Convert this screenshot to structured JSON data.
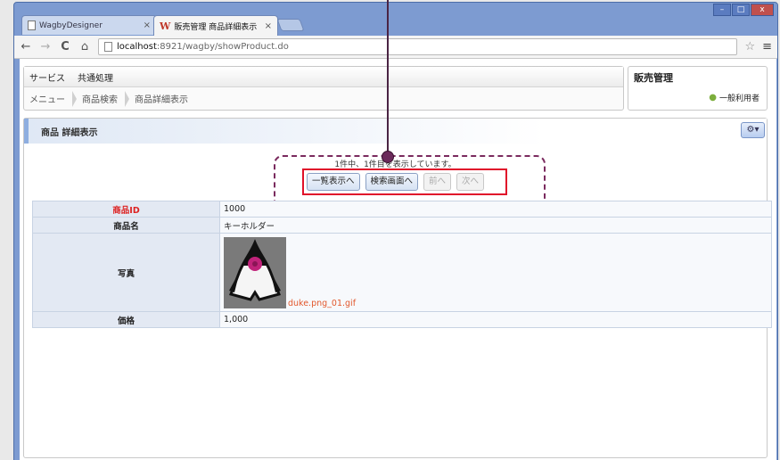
{
  "browser": {
    "tabs": [
      {
        "title": "WagbyDesigner",
        "close": "×"
      },
      {
        "title": "販売管理 商品詳細表示",
        "close": "×",
        "icon_letter": "W"
      }
    ],
    "window_controls": [
      "–",
      "□",
      "x"
    ],
    "nav": {
      "back": "←",
      "forward": "→",
      "reload": "C",
      "home": "⌂"
    },
    "url_host": "localhost",
    "url_rest": ":8921/wagby/showProduct.do",
    "star": "☆",
    "menu": "≡"
  },
  "app": {
    "menu_items": [
      "サービス",
      "共通処理"
    ],
    "breadcrumbs": [
      "メニュー",
      "商品検索",
      "商品詳細表示"
    ],
    "system_title": "販売管理",
    "user_label": "一般利用者"
  },
  "panel": {
    "title": "商品 詳細表示",
    "tool_icon": "⚙▾",
    "count_text": "1件中、1件目を表示しています。",
    "buttons": {
      "list": "一覧表示へ",
      "search": "検索画面へ",
      "prev": "前へ",
      "next": "次へ"
    },
    "fields": [
      {
        "label": "商品ID",
        "value": "1000"
      },
      {
        "label": "商品名",
        "value": "キーホルダー"
      },
      {
        "label": "写真",
        "file": "duke.png_01.gif"
      },
      {
        "label": "価格",
        "value": "1,000"
      }
    ]
  },
  "colors": {
    "accent": "#7d9bd1",
    "highlight_red": "#e0102a",
    "annotation": "#6b2a5b",
    "required_label": "#d22"
  }
}
